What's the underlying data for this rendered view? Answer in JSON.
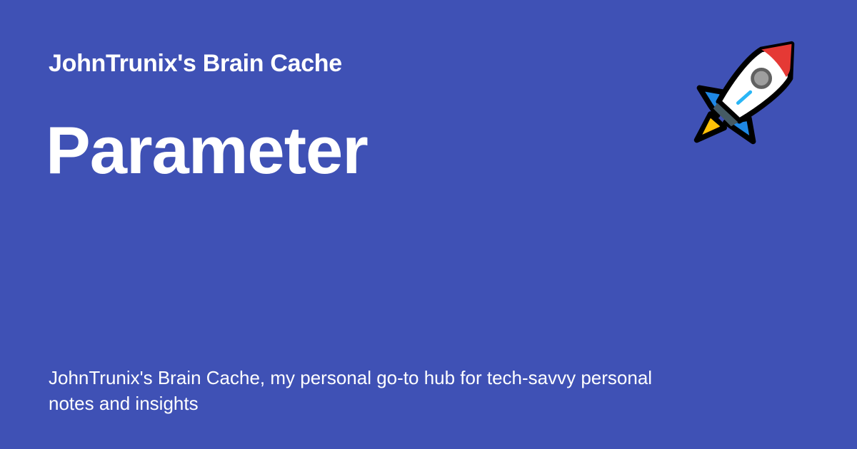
{
  "site": {
    "title": "JohnTrunix's Brain Cache"
  },
  "page": {
    "title": "Parameter",
    "description": "JohnTrunix's Brain Cache, my personal go-to hub for tech-savvy personal notes and insights"
  },
  "decoration": {
    "icon": "rocket-icon"
  },
  "colors": {
    "background": "#3f51b5",
    "text": "#ffffff"
  }
}
